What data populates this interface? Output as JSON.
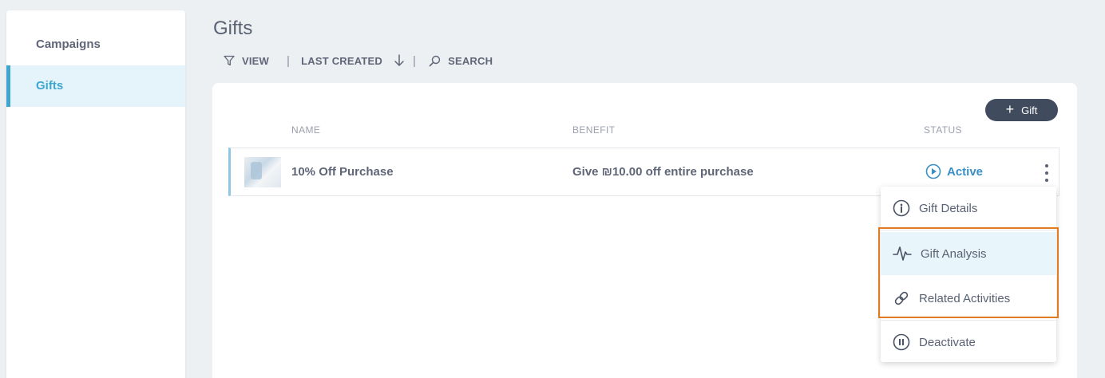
{
  "sidebar": {
    "items": [
      {
        "label": "Campaigns",
        "active": false
      },
      {
        "label": "Gifts",
        "active": true
      }
    ]
  },
  "header": {
    "title": "Gifts"
  },
  "toolbar": {
    "view_label": "VIEW",
    "sort_label": "LAST CREATED",
    "search_label": "SEARCH"
  },
  "card": {
    "add_button_label": "Gift",
    "columns": {
      "name": "NAME",
      "benefit": "BENEFIT",
      "status": "STATUS"
    },
    "rows": [
      {
        "name": "10% Off Purchase",
        "benefit": "Give ₪10.00 off entire purchase",
        "status": "Active"
      }
    ]
  },
  "menu": {
    "items": [
      {
        "label": "Gift Details",
        "icon": "info-icon"
      },
      {
        "label": "Gift Analysis",
        "icon": "pulse-icon"
      },
      {
        "label": "Related Activities",
        "icon": "link-icon"
      },
      {
        "label": "Deactivate",
        "icon": "pause-icon"
      }
    ]
  },
  "colors": {
    "accent": "#3ea6cf",
    "status_active": "#3a8fc6",
    "button_dark": "#414b5e",
    "highlight_border": "#e07b22"
  }
}
